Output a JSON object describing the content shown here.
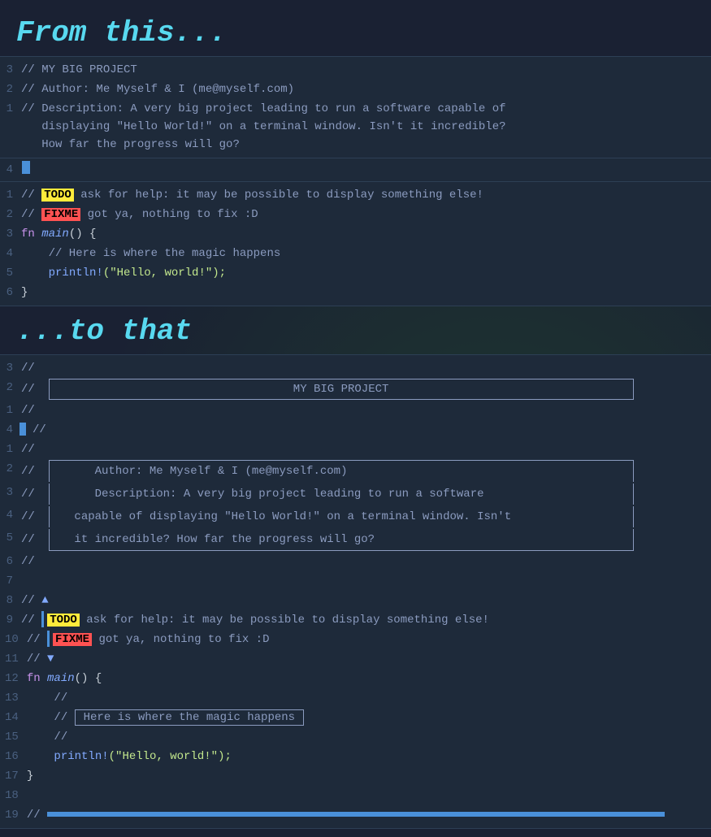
{
  "section1": {
    "title": "From this...",
    "lines": [
      {
        "num": "3",
        "marker": false,
        "content": "// MY BIG PROJECT",
        "type": "comment"
      },
      {
        "num": "2",
        "marker": false,
        "content": "// Author: Me Myself & I (me@myself.com)",
        "type": "comment"
      },
      {
        "num": "1",
        "marker": false,
        "content": "// Description: A very big project leading to run a software capable of",
        "type": "comment"
      },
      {
        "num": "",
        "marker": false,
        "content": "   displaying \"Hello World!\" on a terminal window. Isn't it incredible?",
        "type": "comment"
      },
      {
        "num": "",
        "marker": false,
        "content": "   How far the progress will go?",
        "type": "comment"
      }
    ],
    "lines2": [
      {
        "num": "1",
        "marker": "box",
        "content_parts": [
          {
            "t": "// ",
            "c": "comment"
          },
          {
            "t": "TODO",
            "c": "todo"
          },
          {
            "t": " ask for help: it may be possible to display something else!",
            "c": "comment"
          }
        ]
      },
      {
        "num": "2",
        "marker": false,
        "content_parts": [
          {
            "t": "// ",
            "c": "comment"
          },
          {
            "t": "FIXME",
            "c": "fixme"
          },
          {
            "t": " got ya, nothing to fix :D",
            "c": "comment"
          }
        ]
      },
      {
        "num": "3",
        "marker": false,
        "content_parts": [
          {
            "t": "fn ",
            "c": "keyword"
          },
          {
            "t": "main",
            "c": "func"
          },
          {
            "t": "() {",
            "c": "paren"
          }
        ]
      },
      {
        "num": "4",
        "marker": false,
        "content_parts": [
          {
            "t": "    // Here is where the magic happens",
            "c": "comment"
          }
        ]
      },
      {
        "num": "5",
        "marker": false,
        "content_parts": [
          {
            "t": "    ",
            "c": ""
          },
          {
            "t": "println!",
            "c": "println"
          },
          {
            "t": "(\"Hello, world!\");",
            "c": "string"
          }
        ]
      },
      {
        "num": "6",
        "marker": false,
        "content_parts": [
          {
            "t": "}",
            "c": ""
          }
        ]
      }
    ]
  },
  "section2": {
    "title": "...to that",
    "lines": [
      {
        "num": "3",
        "content": "//"
      },
      {
        "num": "2",
        "content": "//  [BOX_TITLE]"
      },
      {
        "num": "1",
        "content": "//"
      },
      {
        "num": "4",
        "content": "//"
      },
      {
        "num": "1",
        "content": "//  [BOX_DESC]"
      },
      {
        "num": "2",
        "content": "//"
      },
      {
        "num": "3",
        "content": "//"
      },
      {
        "num": "4",
        "content": "//"
      },
      {
        "num": "5",
        "content": "//"
      },
      {
        "num": "6",
        "content": "//"
      },
      {
        "num": "7",
        "content": ""
      },
      {
        "num": "8",
        "content": "// ▲"
      },
      {
        "num": "9",
        "content": "// [TODO_LINE]"
      },
      {
        "num": "10",
        "content": "// [FIXME_LINE]"
      },
      {
        "num": "11",
        "content": "// ▼"
      },
      {
        "num": "12",
        "content": "fn main() {"
      },
      {
        "num": "13",
        "content": "    //"
      },
      {
        "num": "14",
        "content": "    // [ Here is where the magic happens ]"
      },
      {
        "num": "15",
        "content": "    //"
      },
      {
        "num": "16",
        "content": "    println!(\"Hello, world!\");"
      },
      {
        "num": "17",
        "content": "}"
      },
      {
        "num": "18",
        "content": ""
      },
      {
        "num": "19",
        "content": "// [BOTTOM_BAR]"
      }
    ],
    "box_title": "MY BIG PROJECT",
    "box_desc_1": "     Author: Me Myself & I (me@myself.com)",
    "box_desc_2": "     Description: A very big project leading to run a software",
    "box_desc_3": "  capable of displaying \"Hello World!\" on a terminal window. Isn't",
    "box_desc_4": "  it incredible? How far the progress will go?",
    "magic_comment": "Here is where the magic happens"
  },
  "colors": {
    "todo_bg": "#ffeb3b",
    "fixme_bg": "#ff5252",
    "comment": "#8b9bbf",
    "keyword": "#c792ea",
    "func": "#82aaff",
    "string": "#c3e88d",
    "accent": "#58d9f0"
  }
}
